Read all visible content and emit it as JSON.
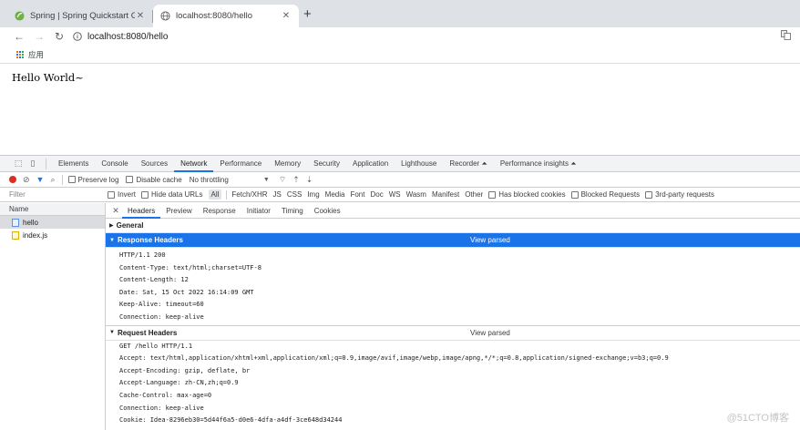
{
  "browser": {
    "tabs": [
      {
        "title": "Spring | Spring Quickstart Gu",
        "active": false
      },
      {
        "title": "localhost:8080/hello",
        "active": true
      }
    ],
    "new_tab_symbol": "+",
    "close_symbol": "✕",
    "url": "localhost:8080/hello",
    "bookmarks": {
      "apps_label": "应用"
    }
  },
  "page": {
    "body_text": "Hello World~"
  },
  "devtools": {
    "panels": [
      "Elements",
      "Console",
      "Sources",
      "Network",
      "Performance",
      "Memory",
      "Security",
      "Application",
      "Lighthouse",
      "Recorder ⏶",
      "Performance insights ⏶"
    ],
    "active_panel": "Network",
    "toolbar": {
      "preserve_log": "Preserve log",
      "disable_cache": "Disable cache",
      "throttling": "No throttling"
    },
    "filter": {
      "placeholder": "Filter",
      "invert": "Invert",
      "hide_data_urls": "Hide data URLs",
      "all": "All",
      "types": [
        "Fetch/XHR",
        "JS",
        "CSS",
        "Img",
        "Media",
        "Font",
        "Doc",
        "WS",
        "Wasm",
        "Manifest",
        "Other"
      ],
      "has_blocked_cookies": "Has blocked cookies",
      "blocked_requests": "Blocked Requests",
      "third_party": "3rd-party requests"
    },
    "requests": {
      "header": "Name",
      "items": [
        {
          "name": "hello",
          "type": "doc",
          "selected": true
        },
        {
          "name": "index.js",
          "type": "js",
          "selected": false
        }
      ]
    },
    "detail": {
      "tabs": [
        "Headers",
        "Preview",
        "Response",
        "Initiator",
        "Timing",
        "Cookies"
      ],
      "active_tab": "Headers",
      "general_label": "General",
      "response_headers": {
        "label": "Response Headers",
        "view_parsed": "View parsed",
        "lines": [
          "HTTP/1.1 200",
          "Content-Type: text/html;charset=UTF-8",
          "Content-Length: 12",
          "Date: Sat, 15 Oct 2022 16:14:09 GMT",
          "Keep-Alive: timeout=60",
          "Connection: keep-alive"
        ]
      },
      "request_headers": {
        "label": "Request Headers",
        "view_parsed": "View parsed",
        "lines": [
          "GET /hello HTTP/1.1",
          "Accept: text/html,application/xhtml+xml,application/xml;q=0.9,image/avif,image/webp,image/apng,*/*;q=0.8,application/signed-exchange;v=b3;q=0.9",
          "Accept-Encoding: gzip, deflate, br",
          "Accept-Language: zh-CN,zh;q=0.9",
          "Cache-Control: max-age=0",
          "Connection: keep-alive",
          "Cookie: Idea-8296eb30=5d44f6a5-d0e6-4dfa-a4df-3ce648d34244"
        ]
      }
    }
  },
  "watermark": "@51CTO博客",
  "colors": {
    "accent": "#1a73e8",
    "record": "#d93025"
  }
}
